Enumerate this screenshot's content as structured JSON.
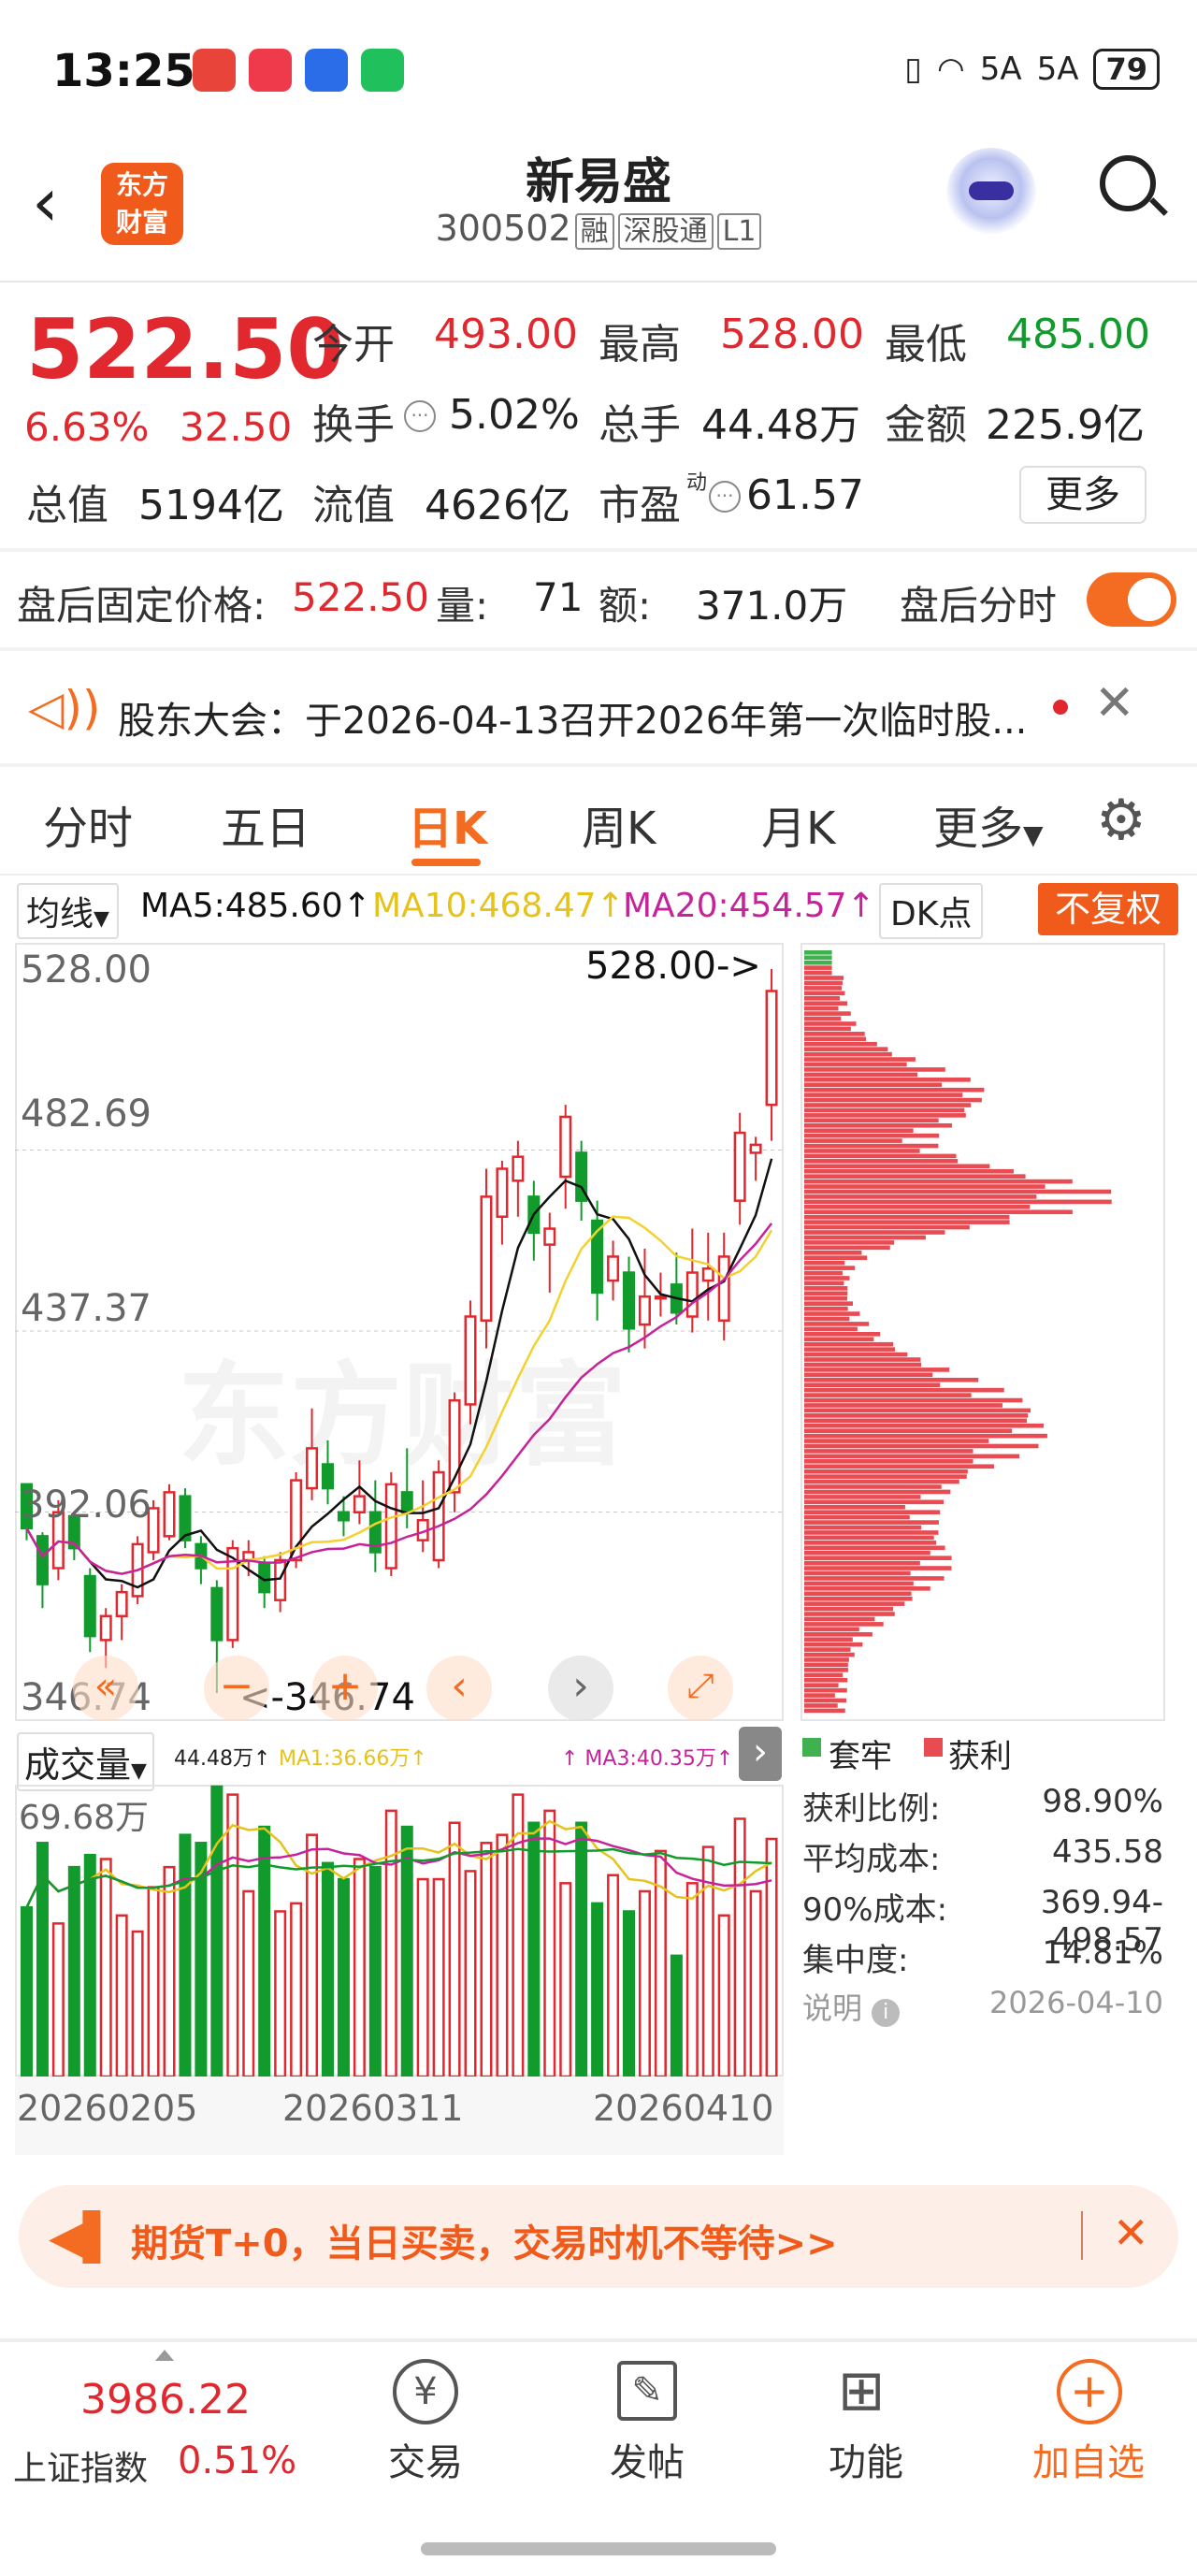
{
  "status_bar": {
    "time": "13:25",
    "battery": "79",
    "network": "5A"
  },
  "header": {
    "title": "新易盛",
    "code": "300502",
    "tags": [
      "融",
      "深股通",
      "L1"
    ],
    "logo_text": [
      "东方",
      "财富"
    ]
  },
  "quote": {
    "price": "522.50",
    "change_pct": "6.63%",
    "change": "32.50",
    "open_label": "今开",
    "open": "493.00",
    "high_label": "最高",
    "high": "528.00",
    "low_label": "最低",
    "low": "485.00",
    "turnover_label": "换手",
    "turnover": "5.02%",
    "volume_label": "总手",
    "volume": "44.48万",
    "amount_label": "金额",
    "amount": "225.9亿",
    "mcap_label": "总值",
    "mcap": "5194亿",
    "float_label": "流值",
    "float": "4626亿",
    "pe_label": "市盈",
    "pe_sup": "动",
    "pe": "61.57",
    "more": "更多"
  },
  "after_hours": {
    "label": "盘后固定价格:",
    "price": "522.50",
    "vol_label": "量:",
    "vol": "71",
    "amt_label": "额:",
    "amt": "371.0万",
    "toggle_label": "盘后分时"
  },
  "notice": {
    "text": "股东大会：于2026-04-13召开2026年第一次临时股..."
  },
  "tabs": [
    "分时",
    "五日",
    "日K",
    "周K",
    "月K",
    "更多"
  ],
  "ma": {
    "selector": "均线",
    "ma5": "MA5:485.60↑",
    "ma10": "MA10:468.47↑",
    "ma20": "MA20:454.57↑",
    "dk": "DK点",
    "fq": "不复权",
    "c5": "#111111",
    "c10": "#f5d130",
    "c20": "#c6239b"
  },
  "watermark": "东方财富",
  "price_axis": {
    "top": "528.00",
    "l2": "482.69",
    "l3": "437.37",
    "l4": "392.06",
    "bottom": "346.74",
    "high_note": "528.00->",
    "low_note": "<-346.74"
  },
  "volume_panel": {
    "selector": "成交量",
    "vol": "44.48万↑",
    "ma1": "MA1:36.66万↑",
    "ma3": "↑ MA3:40.35万↑",
    "max": "69.68万"
  },
  "dates": [
    "20260205",
    "20260311",
    "20260410"
  ],
  "chips": {
    "legend_trap": "套牢",
    "legend_profit": "获利",
    "rows": [
      {
        "label": "获利比例:",
        "value": "98.90%"
      },
      {
        "label": "平均成本:",
        "value": "435.58"
      },
      {
        "label": "90%成本:",
        "value": "369.94-498.57"
      },
      {
        "label": "集中度:",
        "value": "14.81%"
      }
    ],
    "note_label": "说明",
    "date": "2026-04-10"
  },
  "banner": {
    "text": "期货T+0，当日买卖，交易时机不等待>>"
  },
  "bottom_nav": {
    "index_value": "3986.22",
    "index_name": "上证指数",
    "index_pct": "0.51%",
    "items": [
      "交易",
      "发帖",
      "功能",
      "加自选"
    ]
  },
  "colors": {
    "up": "#e0282e",
    "down": "#119b2c",
    "accent": "#f36c21"
  },
  "chart_data": {
    "type": "candlestick",
    "ylim": [
      346.74,
      528.0
    ],
    "candles": [
      [
        399,
        388,
        399,
        385
      ],
      [
        386,
        374,
        387,
        368
      ],
      [
        378,
        392,
        395,
        375
      ],
      [
        391,
        383,
        392,
        380
      ],
      [
        376,
        361,
        378,
        357
      ],
      [
        360,
        366,
        368,
        353
      ],
      [
        366,
        372,
        374,
        360
      ],
      [
        371,
        384,
        386,
        369
      ],
      [
        382,
        393,
        395,
        380
      ],
      [
        386,
        397,
        399,
        385
      ],
      [
        396,
        385,
        398,
        383
      ],
      [
        384,
        378,
        386,
        374
      ],
      [
        373,
        360,
        375,
        346.74
      ],
      [
        360,
        383,
        385,
        358
      ],
      [
        380,
        382,
        385,
        376
      ],
      [
        379,
        372,
        381,
        368
      ],
      [
        370,
        380,
        382,
        367
      ],
      [
        380,
        400,
        402,
        378
      ],
      [
        398,
        408,
        418,
        395
      ],
      [
        404,
        398,
        410,
        394
      ],
      [
        392,
        390,
        396,
        386
      ],
      [
        392,
        396,
        405,
        389
      ],
      [
        392,
        382,
        400,
        377
      ],
      [
        378,
        399,
        402,
        376
      ],
      [
        397,
        392,
        408,
        388
      ],
      [
        385,
        390,
        400,
        382
      ],
      [
        380,
        402,
        405,
        378
      ],
      [
        397,
        420,
        422,
        392
      ],
      [
        419,
        441,
        445,
        414
      ],
      [
        440,
        471,
        478,
        433
      ],
      [
        466,
        478,
        480,
        459
      ],
      [
        475,
        481,
        485,
        466
      ],
      [
        471,
        462,
        475,
        455
      ],
      [
        459,
        463,
        467,
        447
      ],
      [
        476,
        491,
        494,
        468
      ],
      [
        482,
        470,
        485,
        465
      ],
      [
        465,
        447,
        470,
        440
      ],
      [
        450,
        456,
        460,
        445
      ],
      [
        452,
        438,
        456,
        432
      ],
      [
        439,
        446,
        458,
        433
      ],
      [
        446,
        446,
        452,
        441
      ],
      [
        449,
        442,
        457,
        439
      ],
      [
        441,
        452,
        463,
        437
      ],
      [
        450,
        453,
        462,
        440
      ],
      [
        440,
        456,
        462,
        435
      ],
      [
        470,
        487,
        492,
        464
      ],
      [
        482,
        484,
        486,
        475
      ],
      [
        494,
        522.5,
        528,
        485
      ]
    ],
    "volumes": [
      42,
      58,
      38,
      52,
      55,
      54,
      40,
      36,
      47,
      52,
      60,
      58,
      72,
      70,
      46,
      62,
      41,
      43,
      60,
      53,
      49,
      54,
      52,
      66,
      62,
      49,
      49,
      63,
      51,
      58,
      60,
      70,
      63,
      66,
      48,
      63,
      43,
      50,
      41,
      46,
      56,
      30,
      48,
      57,
      40,
      64,
      46,
      59
    ],
    "chip_distribution": "cost profile 346.74-528.00, peak near 450, 98.90% in profit"
  }
}
